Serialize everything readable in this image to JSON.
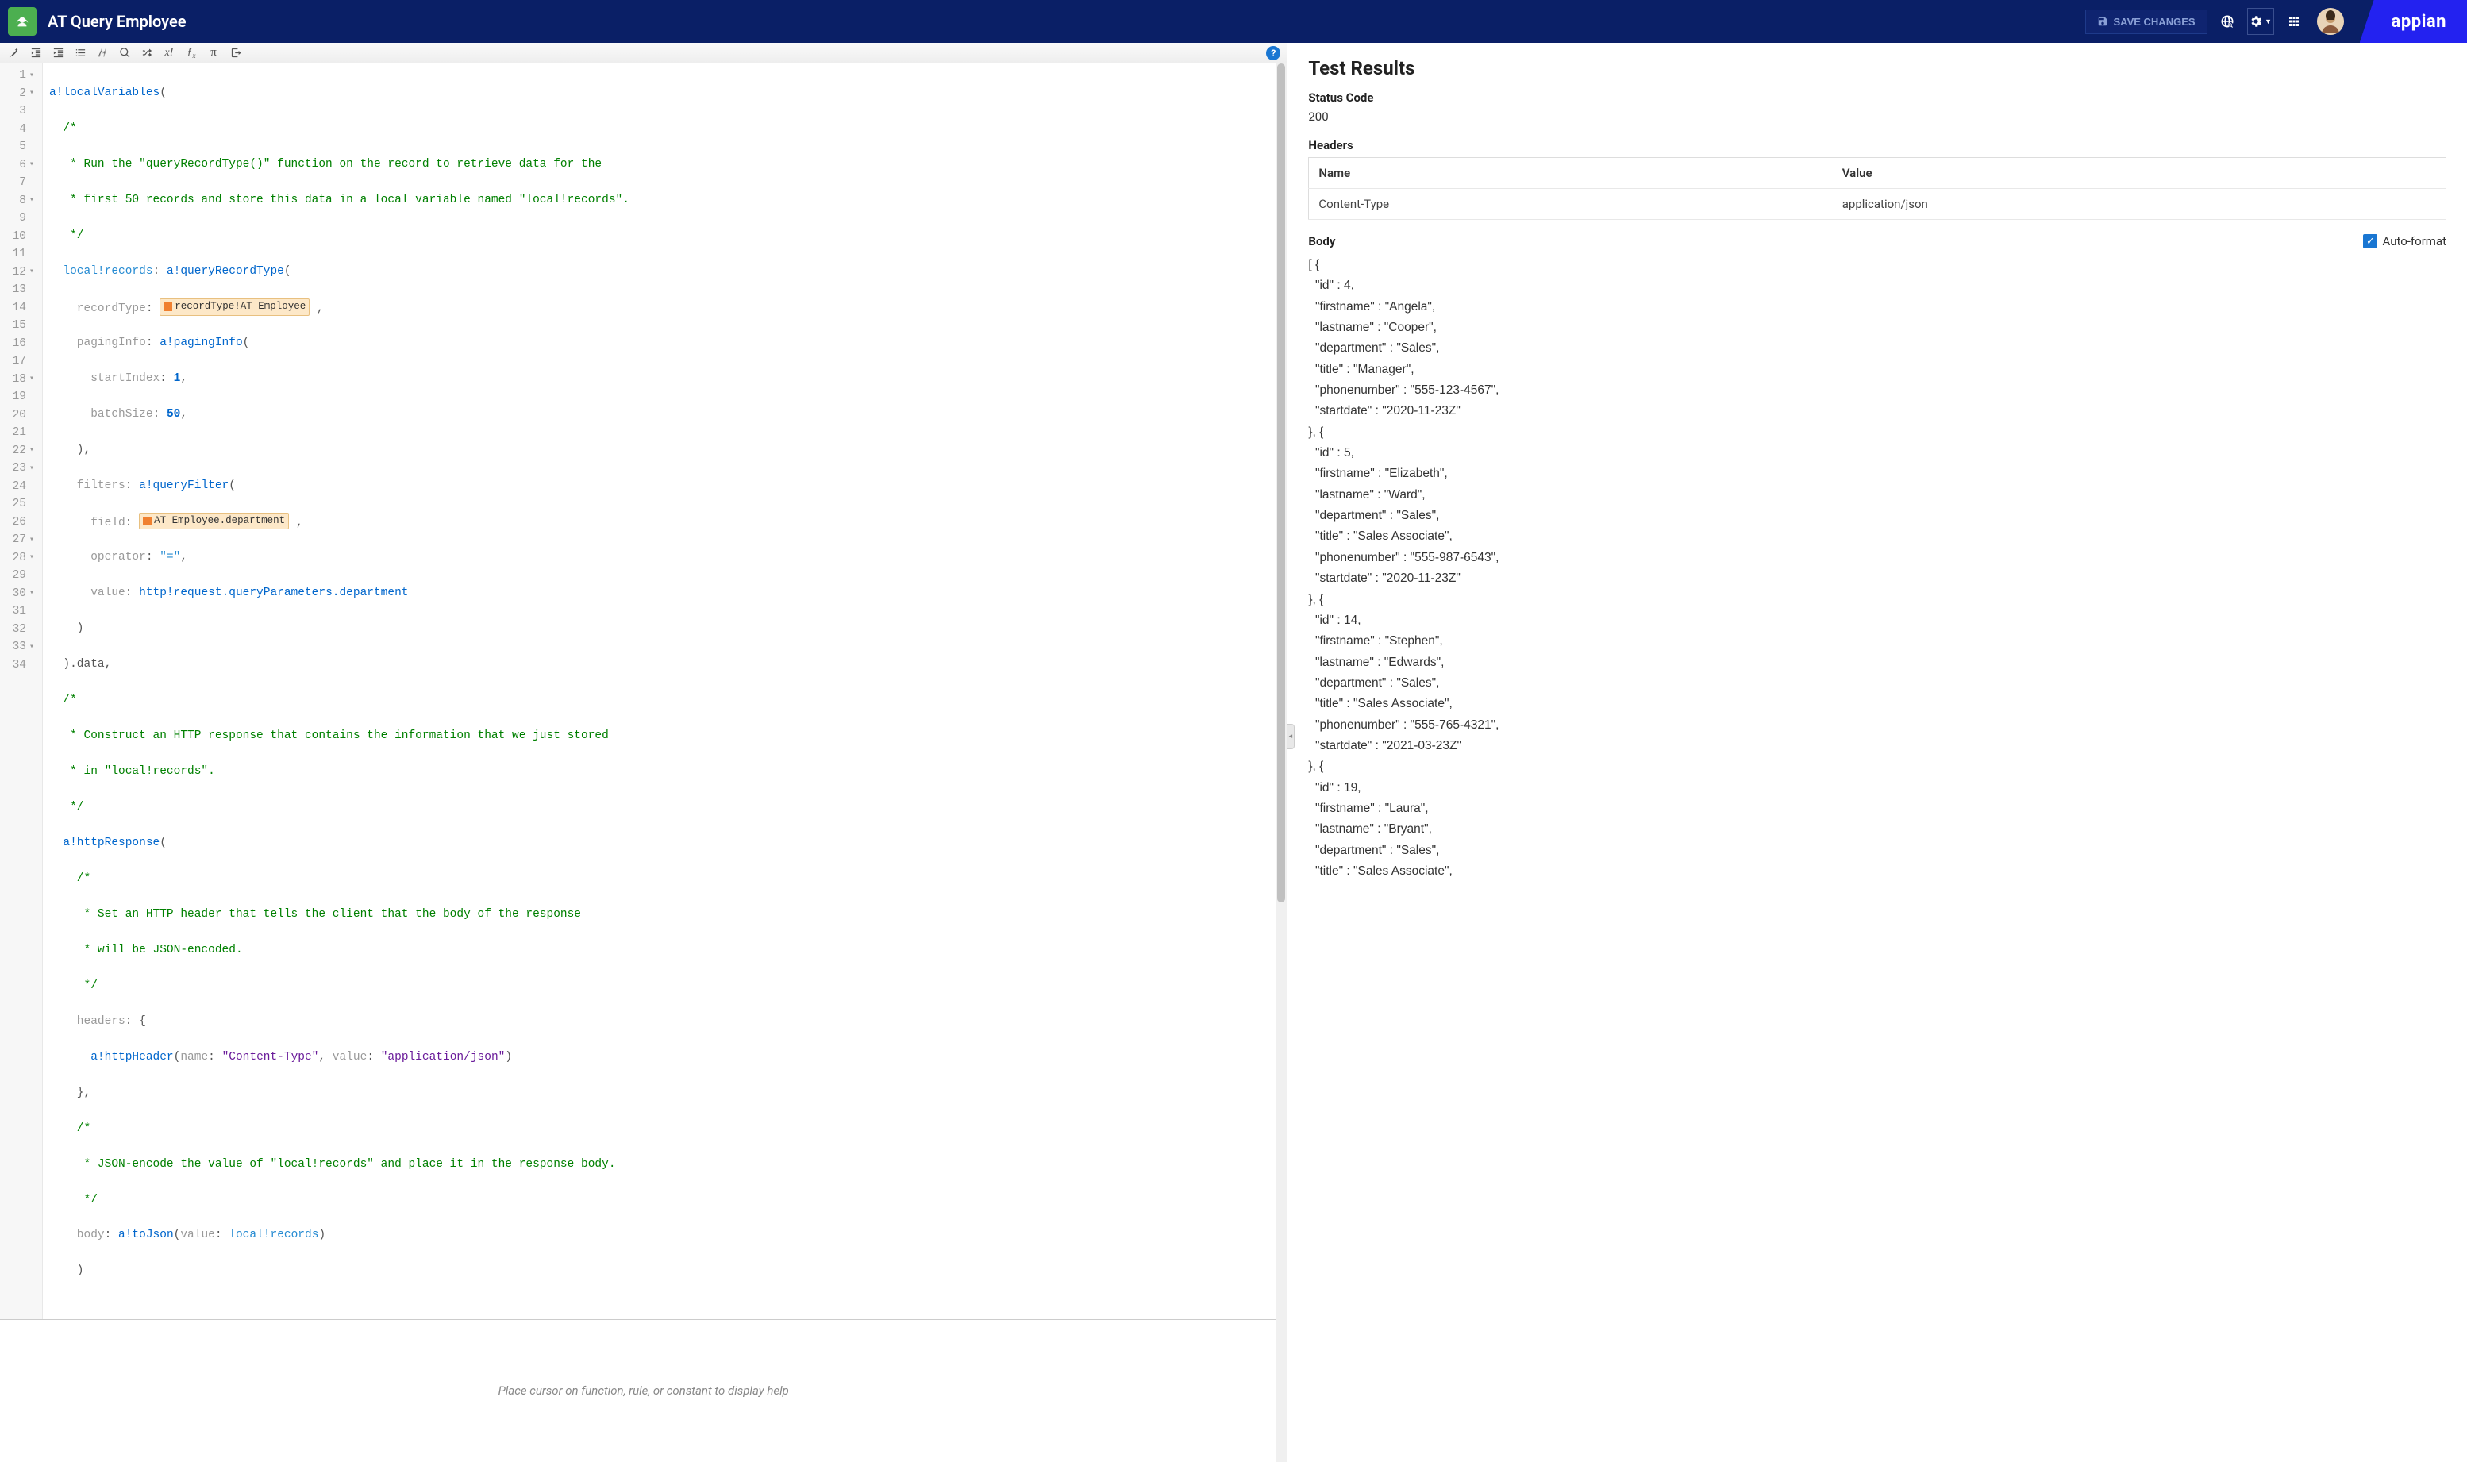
{
  "header": {
    "title": "AT Query Employee",
    "saveLabel": "SAVE CHANGES",
    "brand": "appian"
  },
  "editor": {
    "gutter": [
      {
        "n": "1",
        "fold": "▾"
      },
      {
        "n": "2",
        "fold": "▾"
      },
      {
        "n": "3",
        "fold": ""
      },
      {
        "n": "4",
        "fold": ""
      },
      {
        "n": "5",
        "fold": ""
      },
      {
        "n": "6",
        "fold": "▾"
      },
      {
        "n": "7",
        "fold": ""
      },
      {
        "n": "8",
        "fold": "▾"
      },
      {
        "n": "9",
        "fold": ""
      },
      {
        "n": "10",
        "fold": ""
      },
      {
        "n": "11",
        "fold": ""
      },
      {
        "n": "12",
        "fold": "▾"
      },
      {
        "n": "13",
        "fold": ""
      },
      {
        "n": "14",
        "fold": ""
      },
      {
        "n": "15",
        "fold": ""
      },
      {
        "n": "16",
        "fold": ""
      },
      {
        "n": "17",
        "fold": ""
      },
      {
        "n": "18",
        "fold": "▾"
      },
      {
        "n": "19",
        "fold": ""
      },
      {
        "n": "20",
        "fold": ""
      },
      {
        "n": "21",
        "fold": ""
      },
      {
        "n": "22",
        "fold": "▾"
      },
      {
        "n": "23",
        "fold": "▾"
      },
      {
        "n": "24",
        "fold": ""
      },
      {
        "n": "25",
        "fold": ""
      },
      {
        "n": "26",
        "fold": ""
      },
      {
        "n": "27",
        "fold": "▾"
      },
      {
        "n": "28",
        "fold": "▾"
      },
      {
        "n": "29",
        "fold": ""
      },
      {
        "n": "30",
        "fold": "▾"
      },
      {
        "n": "31",
        "fold": ""
      },
      {
        "n": "32",
        "fold": ""
      },
      {
        "n": "33",
        "fold": "▾"
      },
      {
        "n": "34",
        "fold": ""
      }
    ],
    "chips": {
      "recordType": "recordType!AT Employee",
      "field": "AT Employee.department"
    },
    "text": {
      "l1a": "a!localVariables",
      "l1b": "(",
      "l2": "  /*",
      "l3": "   * Run the \"queryRecordType()\" function on the record to retrieve data for the",
      "l4": "   * first 50 records and store this data in a local variable named \"local!records\".",
      "l5": "   */",
      "l6a": "  local!records",
      "l6b": ": ",
      "l6c": "a!queryRecordType",
      "l6d": "(",
      "l7a": "    recordType",
      "l7b": ": ",
      "l7c": " ,",
      "l8a": "    pagingInfo",
      "l8b": ": ",
      "l8c": "a!pagingInfo",
      "l8d": "(",
      "l9a": "      startIndex",
      "l9b": ": ",
      "l9c": "1",
      "l9d": ",",
      "l10a": "      batchSize",
      "l10b": ": ",
      "l10c": "50",
      "l10d": ",",
      "l11": "    ),",
      "l12a": "    filters",
      "l12b": ": ",
      "l12c": "a!queryFilter",
      "l12d": "(",
      "l13a": "      field",
      "l13b": ": ",
      "l13c": " ,",
      "l14a": "      operator",
      "l14b": ": ",
      "l14c": "\"=\"",
      "l14d": ",",
      "l15a": "      value",
      "l15b": ": ",
      "l15c": "http!request.queryParameters.department",
      "l16": "    )",
      "l17": "  ).data,",
      "l18": "  /*",
      "l19": "   * Construct an HTTP response that contains the information that we just stored",
      "l20": "   * in \"local!records\".",
      "l21": "   */",
      "l22a": "  a!httpResponse",
      "l22b": "(",
      "l23": "    /*",
      "l24": "     * Set an HTTP header that tells the client that the body of the response",
      "l25": "     * will be JSON-encoded.",
      "l26": "     */",
      "l27a": "    headers",
      "l27b": ": {",
      "l28a": "      a!httpHeader",
      "l28b": "(",
      "l28c": "name",
      "l28d": ": ",
      "l28e": "\"Content-Type\"",
      "l28f": ", ",
      "l28g": "value",
      "l28h": ": ",
      "l28i": "\"application/json\"",
      "l28j": ")",
      "l29": "    },",
      "l30": "    /*",
      "l31": "     * JSON-encode the value of \"local!records\" and place it in the response body.",
      "l32": "     */",
      "l33a": "    body",
      "l33b": ": ",
      "l33c": "a!toJson",
      "l33d": "(",
      "l33e": "value",
      "l33f": ": ",
      "l33g": "local!records",
      "l33h": ")",
      "l34": "    )"
    },
    "hint": "Place cursor on function, rule, or constant to display help"
  },
  "results": {
    "title": "Test Results",
    "statusLabel": "Status Code",
    "statusValue": "200",
    "headersLabel": "Headers",
    "headersTable": {
      "colName": "Name",
      "colValue": "Value",
      "rows": [
        {
          "name": "Content-Type",
          "value": "application/json"
        }
      ]
    },
    "bodyLabel": "Body",
    "autoFormatLabel": "Auto-format",
    "bodyJson": "[ {\n  \"id\" : 4,\n  \"firstname\" : \"Angela\",\n  \"lastname\" : \"Cooper\",\n  \"department\" : \"Sales\",\n  \"title\" : \"Manager\",\n  \"phonenumber\" : \"555-123-4567\",\n  \"startdate\" : \"2020-11-23Z\"\n}, {\n  \"id\" : 5,\n  \"firstname\" : \"Elizabeth\",\n  \"lastname\" : \"Ward\",\n  \"department\" : \"Sales\",\n  \"title\" : \"Sales Associate\",\n  \"phonenumber\" : \"555-987-6543\",\n  \"startdate\" : \"2020-11-23Z\"\n}, {\n  \"id\" : 14,\n  \"firstname\" : \"Stephen\",\n  \"lastname\" : \"Edwards\",\n  \"department\" : \"Sales\",\n  \"title\" : \"Sales Associate\",\n  \"phonenumber\" : \"555-765-4321\",\n  \"startdate\" : \"2021-03-23Z\"\n}, {\n  \"id\" : 19,\n  \"firstname\" : \"Laura\",\n  \"lastname\" : \"Bryant\",\n  \"department\" : \"Sales\",\n  \"title\" : \"Sales Associate\","
  }
}
